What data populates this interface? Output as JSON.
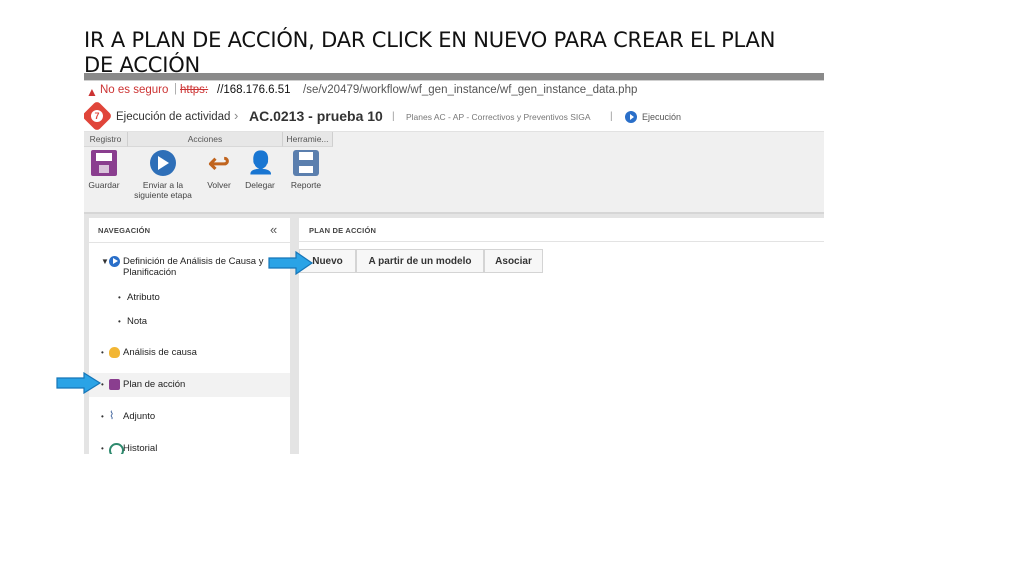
{
  "slide": {
    "title": "IR A PLAN DE ACCIÓN, DAR CLICK EN NUEVO PARA CREAR EL PLAN DE ACCIÓN"
  },
  "browser": {
    "security_warning": "No es seguro",
    "url_protocol": "https:",
    "url_host": "//168.176.6.51",
    "url_path": "/se/v20479/workflow/wf_gen_instance/wf_gen_instance_data.php"
  },
  "app": {
    "title": "Ejecución de actividad",
    "record_title": "AC.0213 - prueba 10",
    "process": "Planes AC - AP - Correctivos y Preventivos SIGA",
    "status": "Ejecución",
    "logo_char": "7"
  },
  "ribbon": {
    "groups": [
      "Registro",
      "Acciones",
      "Herramie..."
    ],
    "buttons": {
      "save": "Guardar",
      "send": "Enviar a la siguiente etapa",
      "back": "Volver",
      "delegate": "Delegar",
      "report": "Reporte"
    }
  },
  "navigation": {
    "title": "NAVEGACIÓN",
    "collapse_glyph": "«",
    "items": {
      "definicion": "Definición de Análisis de Causa y Planificación",
      "atributo": "Atributo",
      "nota": "Nota",
      "analisis": "Análisis de causa",
      "plan": "Plan de acción",
      "adjunto": "Adjunto",
      "historial": "Historial"
    }
  },
  "panel": {
    "title": "PLAN DE ACCIÓN",
    "buttons": {
      "nuevo": "Nuevo",
      "modelo": "A partir de un modelo",
      "asociar": "Asociar"
    }
  },
  "colors": {
    "annotation_arrow": "#2aa3e6",
    "brand_red": "#e0453a",
    "brand_blue": "#2a6fc9"
  }
}
